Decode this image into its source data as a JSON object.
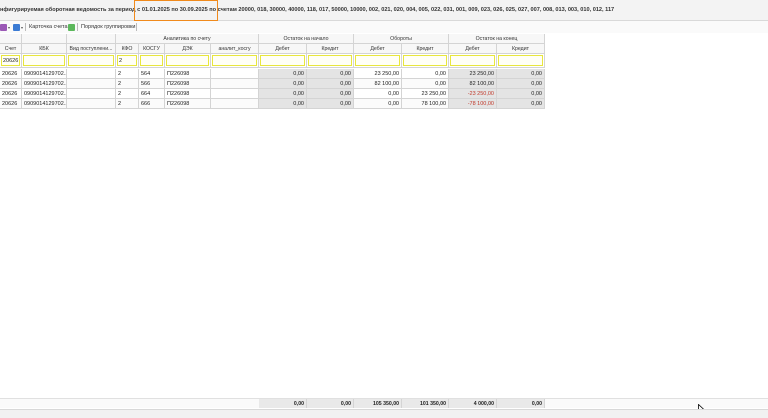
{
  "title": {
    "before": "нфигурируемая оборотная ведомость за период ",
    "period": "с 01.01.2025 по 30.09.2025",
    "after": " по счетам 20000, 018, 30000, 40000, 118, 017, 50000, 10000, 002, 021, 020, 004, 005, 022, 031, 001, 009, 023, 026, 025, 027, 007, 008, 013, 003, 010, 012, 117"
  },
  "toolbar": {
    "card_label": "Карточка счета",
    "grouping_label": "Порядок группировки"
  },
  "colors": {
    "accent_highlight": "#f08a1c",
    "negative": "#c0392b",
    "filter_border": "#e8e63d"
  },
  "header": {
    "group_analytics": "Аналитика по счету",
    "group_open": "Остаток на начало",
    "group_turnover": "Обороты",
    "group_close": "Остаток на конец",
    "col_account": "Счет",
    "col_kvk": "КБК",
    "col_receipt": "Вид поступлени...",
    "col_kfo": "КФО",
    "col_kosgu": "КОСГУ",
    "col_dek": "ДЭК",
    "col_analyt": "аналит_косгу",
    "col_debit": "Дебет",
    "col_credit": "Кредит"
  },
  "filters": {
    "account": "20626",
    "kfo": "2"
  },
  "rows": [
    {
      "account": "20626",
      "kbk": "0909014129702...",
      "receipt": "",
      "kfo": "2",
      "kosgu": "564",
      "dek": "П226098",
      "analyt": "",
      "ob_deb": "0,00",
      "ob_cred": "0,00",
      "t_deb": "23 250,00",
      "t_cred": "0,00",
      "c_deb": "23 250,00",
      "c_cred": "0,00",
      "c_deb_neg": false
    },
    {
      "account": "20626",
      "kbk": "0909014129702...",
      "receipt": "",
      "kfo": "2",
      "kosgu": "566",
      "dek": "П226098",
      "analyt": "",
      "ob_deb": "0,00",
      "ob_cred": "0,00",
      "t_deb": "82 100,00",
      "t_cred": "0,00",
      "c_deb": "82 100,00",
      "c_cred": "0,00",
      "c_deb_neg": false
    },
    {
      "account": "20626",
      "kbk": "0909014129702...",
      "receipt": "",
      "kfo": "2",
      "kosgu": "664",
      "dek": "П226098",
      "analyt": "",
      "ob_deb": "0,00",
      "ob_cred": "0,00",
      "t_deb": "0,00",
      "t_cred": "23 250,00",
      "c_deb": "-23 250,00",
      "c_cred": "0,00",
      "c_deb_neg": true
    },
    {
      "account": "20626",
      "kbk": "0909014129702...",
      "receipt": "",
      "kfo": "2",
      "kosgu": "666",
      "dek": "П226098",
      "analyt": "",
      "ob_deb": "0,00",
      "ob_cred": "0,00",
      "t_deb": "0,00",
      "t_cred": "78 100,00",
      "c_deb": "-78 100,00",
      "c_cred": "0,00",
      "c_deb_neg": true
    }
  ],
  "totals": {
    "ob_deb": "0,00",
    "ob_cred": "0,00",
    "t_deb": "105 350,00",
    "t_cred": "101 350,00",
    "c_deb": "4 000,00",
    "c_cred": "0,00"
  }
}
